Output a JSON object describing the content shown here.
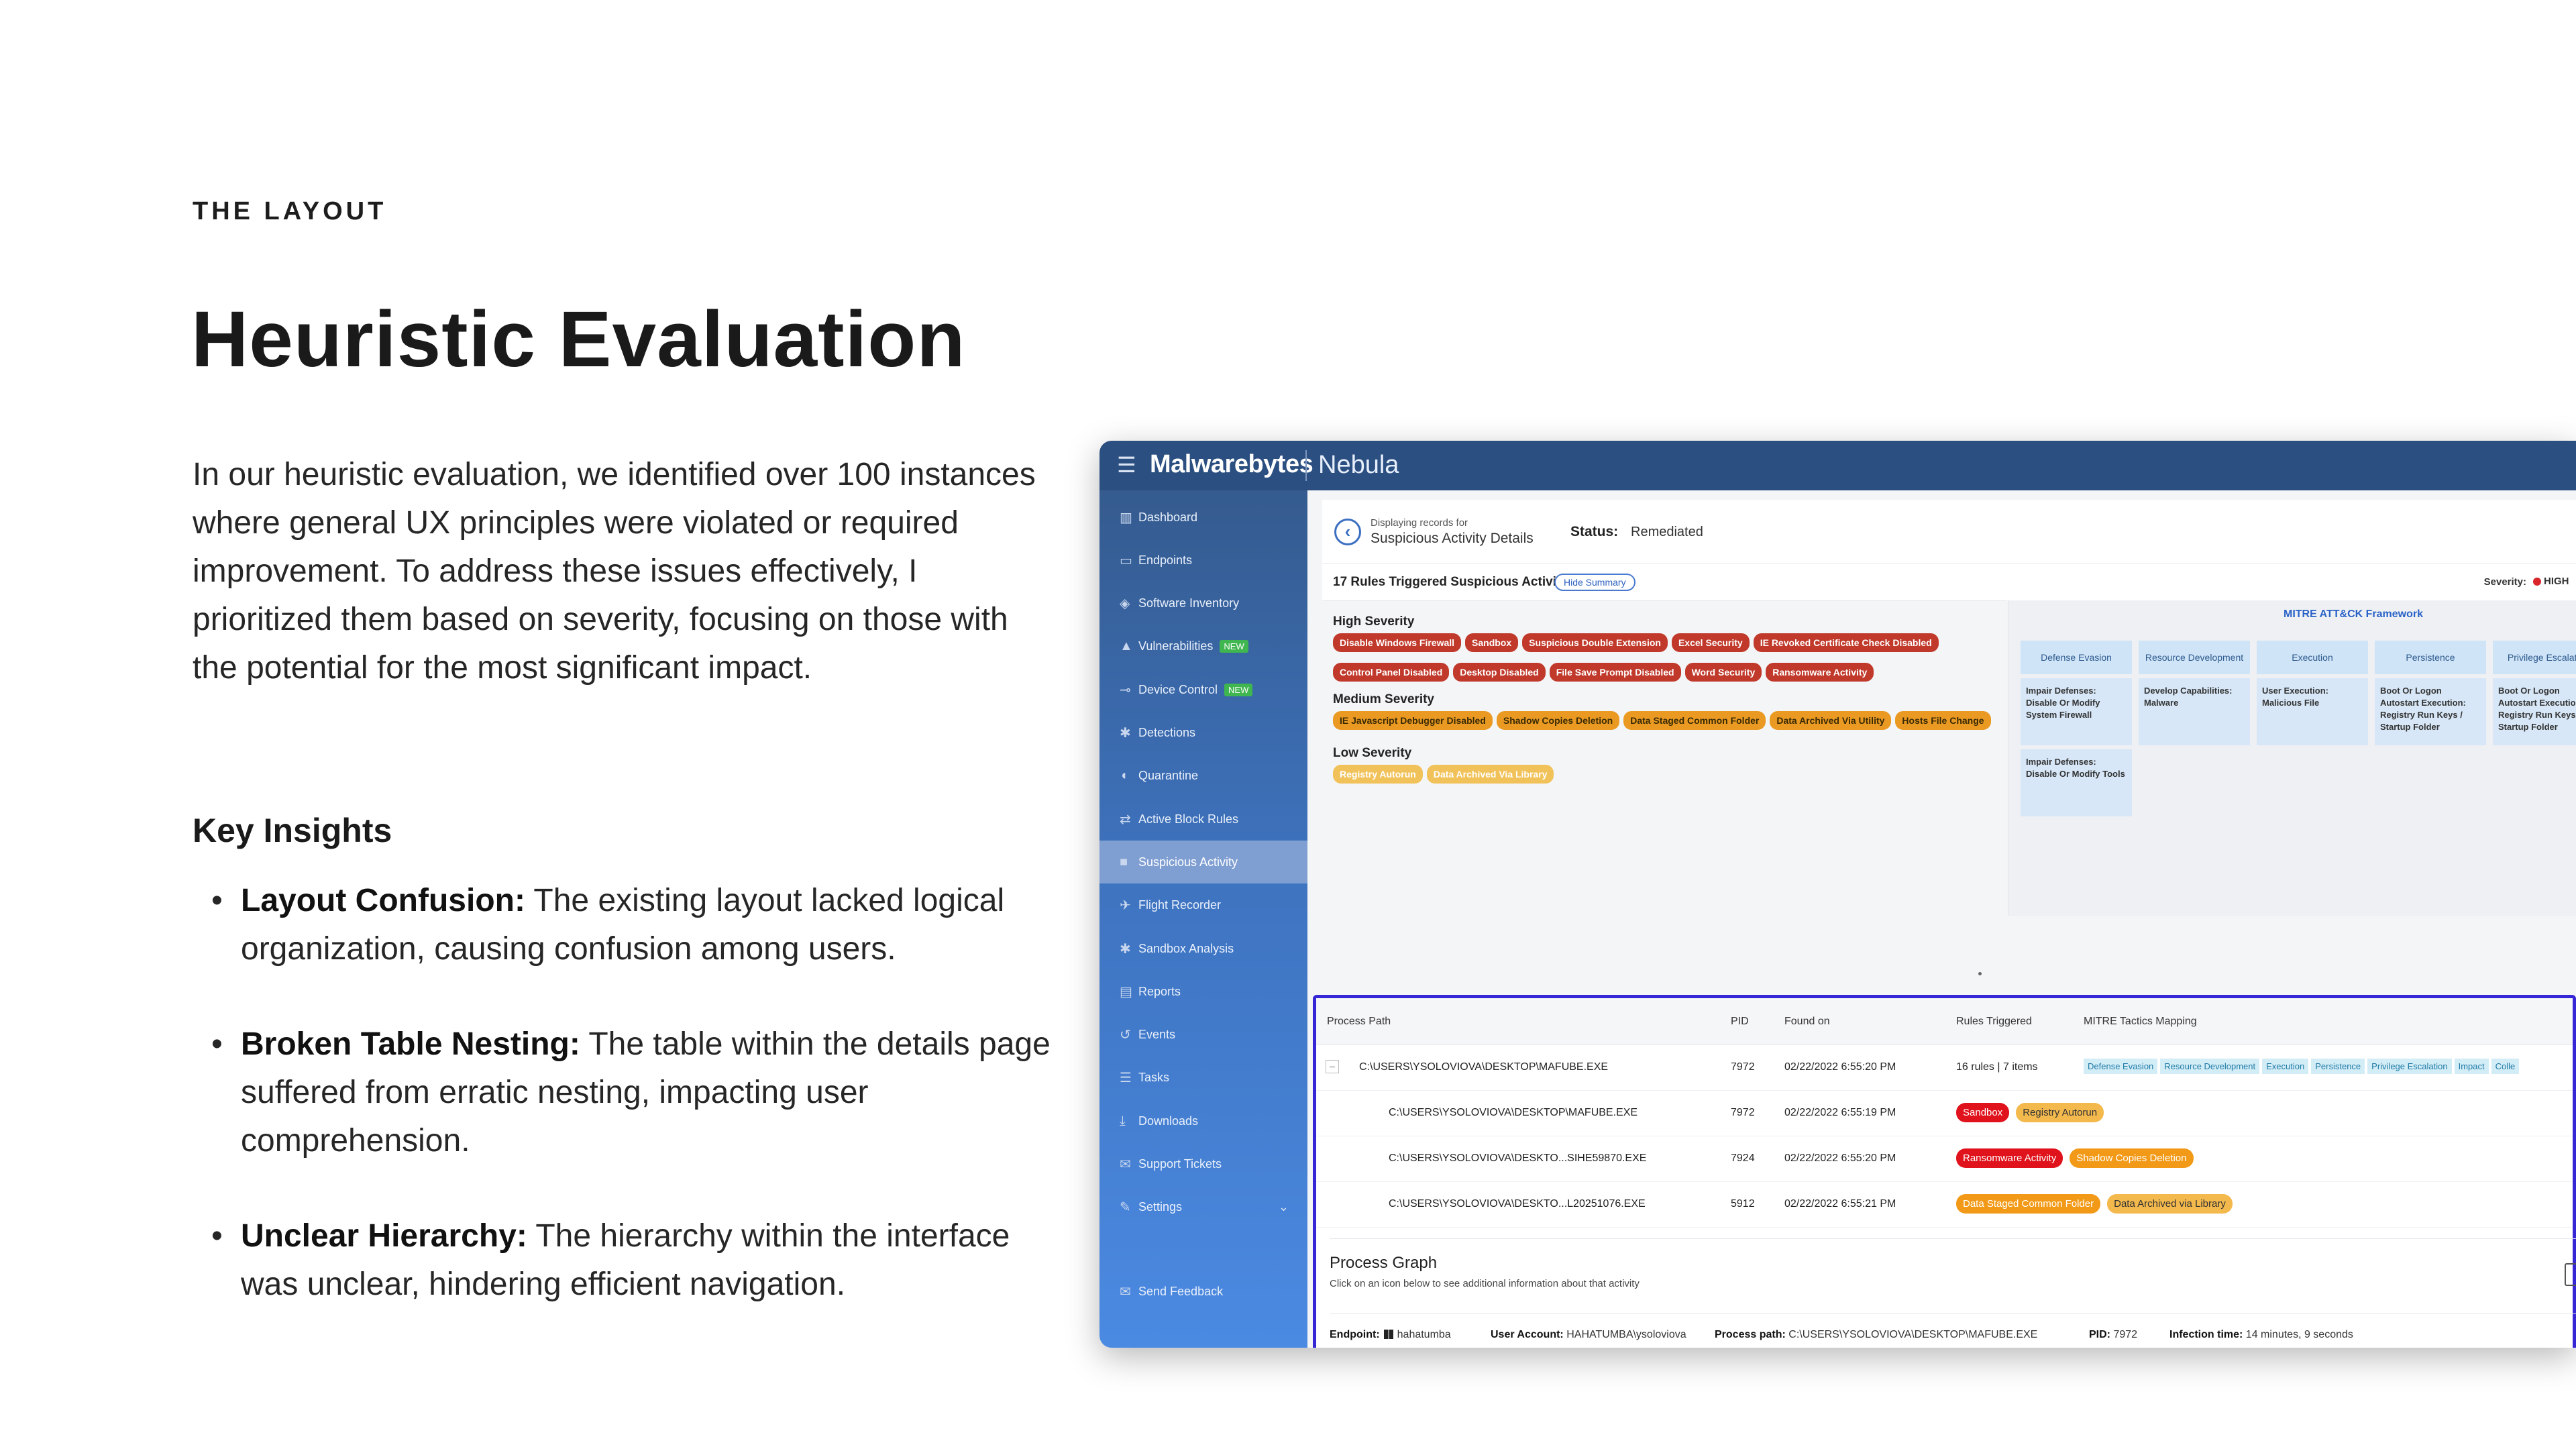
{
  "slide": {
    "eyebrow": "THE LAYOUT",
    "title": "Heuristic Evaluation",
    "intro": "In our heuristic evaluation, we identified over 100 instances where general UX principles were violated or required improvement. To address these issues effectively, I prioritized them based on severity, focusing on those with the potential for the most significant impact.",
    "key_insights_title": "Key Insights",
    "insights": [
      {
        "title": "Layout Confusion:",
        "text": " The existing layout lacked logical organization, causing confusion among users."
      },
      {
        "title": "Broken Table Nesting:",
        "text": " The table within the details page suffered from erratic nesting, impacting user comprehension."
      },
      {
        "title": "Unclear Hierarchy:",
        "text": " The hierarchy within the interface was unclear, hindering efficient navigation."
      }
    ]
  },
  "app": {
    "brand": "Malwarebytes",
    "product": "Nebula",
    "sidebar": [
      {
        "label": "Dashboard",
        "icon": "chart-icon",
        "glyph": "▥"
      },
      {
        "label": "Endpoints",
        "icon": "monitor-icon",
        "glyph": "▭"
      },
      {
        "label": "Software Inventory",
        "icon": "tag-icon",
        "glyph": "◈"
      },
      {
        "label": "Vulnerabilities",
        "icon": "warning-icon",
        "glyph": "▲",
        "badge": "NEW"
      },
      {
        "label": "Device Control",
        "icon": "usb-icon",
        "glyph": "⊸",
        "badge": "NEW"
      },
      {
        "label": "Detections",
        "icon": "bug-icon",
        "glyph": "✱"
      },
      {
        "label": "Quarantine",
        "icon": "shield-icon",
        "glyph": "◖"
      },
      {
        "label": "Active Block Rules",
        "icon": "arrows-icon",
        "glyph": "⇄"
      },
      {
        "label": "Suspicious Activity",
        "icon": "lock-icon",
        "glyph": "■",
        "active": true
      },
      {
        "label": "Flight Recorder",
        "icon": "plane-icon",
        "glyph": "✈"
      },
      {
        "label": "Sandbox Analysis",
        "icon": "bug-icon",
        "glyph": "✱"
      },
      {
        "label": "Reports",
        "icon": "document-icon",
        "glyph": "▤"
      },
      {
        "label": "Events",
        "icon": "history-icon",
        "glyph": "↺"
      },
      {
        "label": "Tasks",
        "icon": "list-icon",
        "glyph": "☰"
      },
      {
        "label": "Downloads",
        "icon": "download-icon",
        "glyph": "⤓"
      },
      {
        "label": "Support Tickets",
        "icon": "chat-icon",
        "glyph": "✉"
      },
      {
        "label": "Settings",
        "icon": "wrench-icon",
        "glyph": "✎",
        "chevron": "⌄"
      }
    ],
    "send_feedback": "Send Feedback",
    "header": {
      "displaying": "Displaying records for",
      "page": "Suspicious Activity Details",
      "status_label": "Status:",
      "status_value": "Remediated"
    },
    "rules": {
      "count_text": "17 Rules Triggered Suspicious Activity",
      "hide_summary": "Hide Summary",
      "severity_label": "Severity:",
      "severity_value": "HIGH"
    },
    "severity": {
      "high_title": "High Severity",
      "high_row1": [
        "Disable Windows Firewall",
        "Sandbox",
        "Suspicious Double Extension",
        "Excel Security",
        "IE Revoked Certificate Check Disabled"
      ],
      "high_row2": [
        "Control Panel Disabled",
        "Desktop Disabled",
        "File Save Prompt Disabled",
        "Word Security",
        "Ransomware Activity"
      ],
      "medium_title": "Medium Severity",
      "medium": [
        "IE Javascript Debugger Disabled",
        "Shadow Copies Deletion",
        "Data Staged Common Folder",
        "Data Archived Via Utility",
        "Hosts File Change"
      ],
      "low_title": "Low Severity",
      "low": [
        "Registry Autorun",
        "Data Archived Via Library"
      ]
    },
    "mitre": {
      "title": "MITRE ATT&CK Framework",
      "columns": [
        {
          "head": "Defense Evasion",
          "cells": [
            "Impair Defenses: Disable Or Modify System Firewall",
            "Impair Defenses: Disable Or Modify Tools"
          ]
        },
        {
          "head": "Resource Development",
          "cells": [
            "Develop Capabilities: Malware"
          ]
        },
        {
          "head": "Execution",
          "cells": [
            "User Execution: Malicious File"
          ]
        },
        {
          "head": "Persistence",
          "cells": [
            "Boot Or Logon Autostart Execution: Registry Run Keys / Startup Folder"
          ]
        },
        {
          "head": "Privilege Escalation",
          "cells": [
            "Boot Or Logon Autostart Execution: Registry Run Keys / Startup Folder"
          ]
        }
      ]
    },
    "table": {
      "headers": [
        "Process Path",
        "PID",
        "Found on",
        "Rules Triggered",
        "MITRE Tactics Mapping"
      ],
      "parent": {
        "toggle": "–",
        "path": "C:\\USERS\\YSOLOVIOVA\\DESKTOP\\MAFUBE.EXE",
        "pid": "7972",
        "found": "02/22/2022 6:55:20 PM",
        "rules": "16 rules | 7 items",
        "tactics": [
          "Defense Evasion",
          "Resource Development",
          "Execution",
          "Persistence",
          "Privilege Escalation",
          "Impact",
          "Colle"
        ]
      },
      "children": [
        {
          "path": "C:\\USERS\\YSOLOVIOVA\\DESKTOP\\MAFUBE.EXE",
          "pid": "7972",
          "found": "02/22/2022 6:55:19 PM",
          "tag1": "Sandbox",
          "tag2": "Registry Autorun"
        },
        {
          "path": "C:\\USERS\\YSOLOVIOVA\\DESKTO...SIHE59870.EXE",
          "pid": "7924",
          "found": "02/22/2022 6:55:20 PM",
          "tag1": "Ransomware Activity",
          "tag2": "Shadow Copies Deletion"
        },
        {
          "path": "C:\\USERS\\YSOLOVIOVA\\DESKTO...L20251076.EXE",
          "pid": "5912",
          "found": "02/22/2022 6:55:21 PM",
          "tag1": "Data Staged Common Folder",
          "tag2": "Data Archived via Library"
        }
      ]
    },
    "process_graph": {
      "title": "Process Graph",
      "subtitle": "Click on an icon below to see additional information about that activity"
    },
    "meta": {
      "endpoint_label": "Endpoint:",
      "endpoint_value": "hahatumba",
      "user_label": "User Account:",
      "user_value": "HAHATUMBA\\ysoloviova",
      "path_label": "Process path:",
      "path_value": "C:\\USERS\\YSOLOVIOVA\\DESKTOP\\MAFUBE.EXE",
      "pid_label": "PID:",
      "pid_value": "7972",
      "infection_label": "Infection time:",
      "infection_value": "14 minutes, 9 seconds"
    },
    "colors": {
      "topbar": "#2b4f80",
      "highlight_border": "#3526d6",
      "high": "#c0392b",
      "medium": "#ea9a22",
      "low": "#f2c25a"
    }
  }
}
